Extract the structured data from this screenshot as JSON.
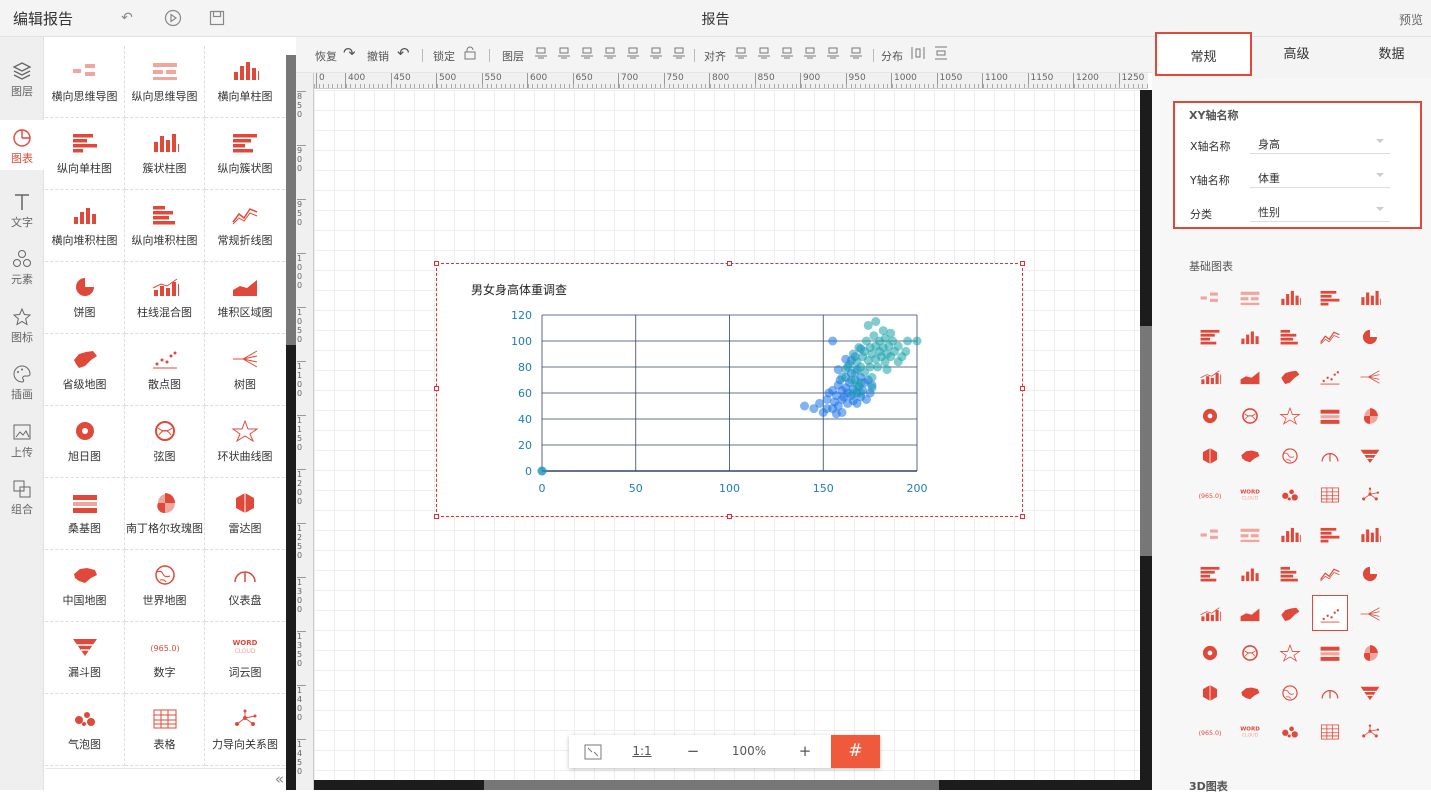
{
  "header": {
    "title": "编辑报告",
    "center_title": "报告",
    "preview": "预览"
  },
  "leftnav": [
    {
      "label": "图层",
      "icon": "layers-icon"
    },
    {
      "label": "图表",
      "icon": "chart-icon",
      "active": true
    },
    {
      "label": "文字",
      "icon": "text-icon"
    },
    {
      "label": "元素",
      "icon": "elements-icon"
    },
    {
      "label": "图标",
      "icon": "star-icon"
    },
    {
      "label": "插画",
      "icon": "palette-icon"
    },
    {
      "label": "上传",
      "icon": "upload-image-icon"
    },
    {
      "label": "组合",
      "icon": "group-icon"
    }
  ],
  "palette": [
    "横向思维导图",
    "纵向思维导图",
    "横向单柱图",
    "纵向单柱图",
    "簇状柱图",
    "纵向簇状图",
    "横向堆积柱图",
    "纵向堆积柱图",
    "常规折线图",
    "饼图",
    "柱线混合图",
    "堆积区域图",
    "省级地图",
    "散点图",
    "树图",
    "旭日图",
    "弦图",
    "环状曲线图",
    "桑基图",
    "南丁格尔玫瑰图",
    "雷达图",
    "中国地图",
    "世界地图",
    "仪表盘",
    "漏斗图",
    "数字",
    "词云图",
    "气泡图",
    "表格",
    "力导向关系图"
  ],
  "palette_texts": {
    "number_badge": "965.0",
    "wordcloud_top": "WORD",
    "wordcloud_bottom": "CLOUD"
  },
  "toolbar": {
    "redo": "恢复",
    "undo": "撤销",
    "lock": "锁定",
    "layer": "图层",
    "align": "对齐",
    "distribute": "分布"
  },
  "ruler_ticks": [
    "0",
    "400",
    "450",
    "500",
    "550",
    "600",
    "650",
    "700",
    "750",
    "800",
    "850",
    "900",
    "950",
    "1000",
    "1050",
    "1100",
    "1150",
    "1200",
    "1250"
  ],
  "ruler_v_ticks": [
    "850",
    "900",
    "950",
    "1000",
    "1050",
    "1100",
    "1150",
    "1200",
    "1250",
    "1300",
    "1350",
    "1400",
    "1450"
  ],
  "zoom": {
    "fit": "⛶",
    "one_to_one": "1:1",
    "minus": "−",
    "level": "100%",
    "plus": "+",
    "grid": "#"
  },
  "right_tabs": [
    "常规",
    "高级",
    "数据"
  ],
  "right_panel": {
    "section_axis": "XY轴名称",
    "x_label": "X轴名称",
    "x_value": "身高",
    "y_label": "Y轴名称",
    "y_value": "体重",
    "cat_label": "分类",
    "cat_value": "性别",
    "section_basic": "基础图表",
    "section_3d": "3D图表"
  },
  "colors": {
    "accent": "#e0493a",
    "series_a": "#1a73e8",
    "series_b": "#17a2a8",
    "axis": "#334466"
  },
  "chart_data": {
    "type": "scatter",
    "title": "男女身高体重调查",
    "xlabel": "",
    "ylabel": "",
    "xlim": [
      0,
      200
    ],
    "ylim": [
      0,
      120
    ],
    "x_ticks": [
      0,
      50,
      100,
      150,
      200
    ],
    "y_ticks": [
      0,
      20,
      40,
      60,
      80,
      100,
      120
    ],
    "series": [
      {
        "color": "#1a73e8",
        "points": [
          [
            0,
            0
          ],
          [
            140,
            50
          ],
          [
            145,
            48
          ],
          [
            148,
            52
          ],
          [
            150,
            45
          ],
          [
            152,
            55
          ],
          [
            153,
            60
          ],
          [
            155,
            48
          ],
          [
            155,
            62
          ],
          [
            156,
            53
          ],
          [
            157,
            58
          ],
          [
            158,
            50
          ],
          [
            158,
            66
          ],
          [
            159,
            70
          ],
          [
            160,
            55
          ],
          [
            160,
            62
          ],
          [
            161,
            57
          ],
          [
            162,
            64
          ],
          [
            162,
            72
          ],
          [
            163,
            60
          ],
          [
            163,
            52
          ],
          [
            164,
            68
          ],
          [
            165,
            58
          ],
          [
            165,
            75
          ],
          [
            166,
            63
          ],
          [
            166,
            54
          ],
          [
            167,
            70
          ],
          [
            168,
            60
          ],
          [
            168,
            78
          ],
          [
            169,
            65
          ],
          [
            170,
            57
          ],
          [
            170,
            72
          ],
          [
            171,
            62
          ],
          [
            172,
            68
          ],
          [
            173,
            55
          ],
          [
            174,
            70
          ],
          [
            175,
            60
          ],
          [
            176,
            66
          ],
          [
            168,
            52
          ],
          [
            160,
            45
          ],
          [
            157,
            44
          ],
          [
            152,
            48
          ],
          [
            165,
            85
          ],
          [
            163,
            80
          ],
          [
            158,
            78
          ],
          [
            162,
            86
          ],
          [
            167,
            88
          ],
          [
            155,
            100
          ],
          [
            170,
            94
          ]
        ]
      },
      {
        "color": "#17a2a8",
        "points": [
          [
            0,
            0
          ],
          [
            160,
            72
          ],
          [
            162,
            78
          ],
          [
            164,
            82
          ],
          [
            165,
            70
          ],
          [
            166,
            90
          ],
          [
            167,
            76
          ],
          [
            168,
            84
          ],
          [
            169,
            95
          ],
          [
            170,
            80
          ],
          [
            170,
            68
          ],
          [
            171,
            88
          ],
          [
            172,
            92
          ],
          [
            172,
            76
          ],
          [
            173,
            100
          ],
          [
            174,
            85
          ],
          [
            175,
            80
          ],
          [
            175,
            95
          ],
          [
            176,
            90
          ],
          [
            176,
            72
          ],
          [
            177,
            104
          ],
          [
            178,
            86
          ],
          [
            178,
            96
          ],
          [
            179,
            80
          ],
          [
            180,
            92
          ],
          [
            180,
            100
          ],
          [
            181,
            88
          ],
          [
            182,
            95
          ],
          [
            183,
            84
          ],
          [
            183,
            102
          ],
          [
            184,
            90
          ],
          [
            185,
            96
          ],
          [
            186,
            88
          ],
          [
            187,
            100
          ],
          [
            188,
            92
          ],
          [
            190,
            96
          ],
          [
            192,
            88
          ],
          [
            195,
            100
          ],
          [
            200,
            100
          ],
          [
            178,
            115
          ],
          [
            182,
            108
          ],
          [
            174,
            112
          ],
          [
            186,
            106
          ],
          [
            170,
            60
          ],
          [
            176,
            64
          ],
          [
            184,
            78
          ],
          [
            190,
            84
          ],
          [
            194,
            92
          ],
          [
            168,
            66
          ],
          [
            166,
            60
          ]
        ]
      }
    ]
  }
}
